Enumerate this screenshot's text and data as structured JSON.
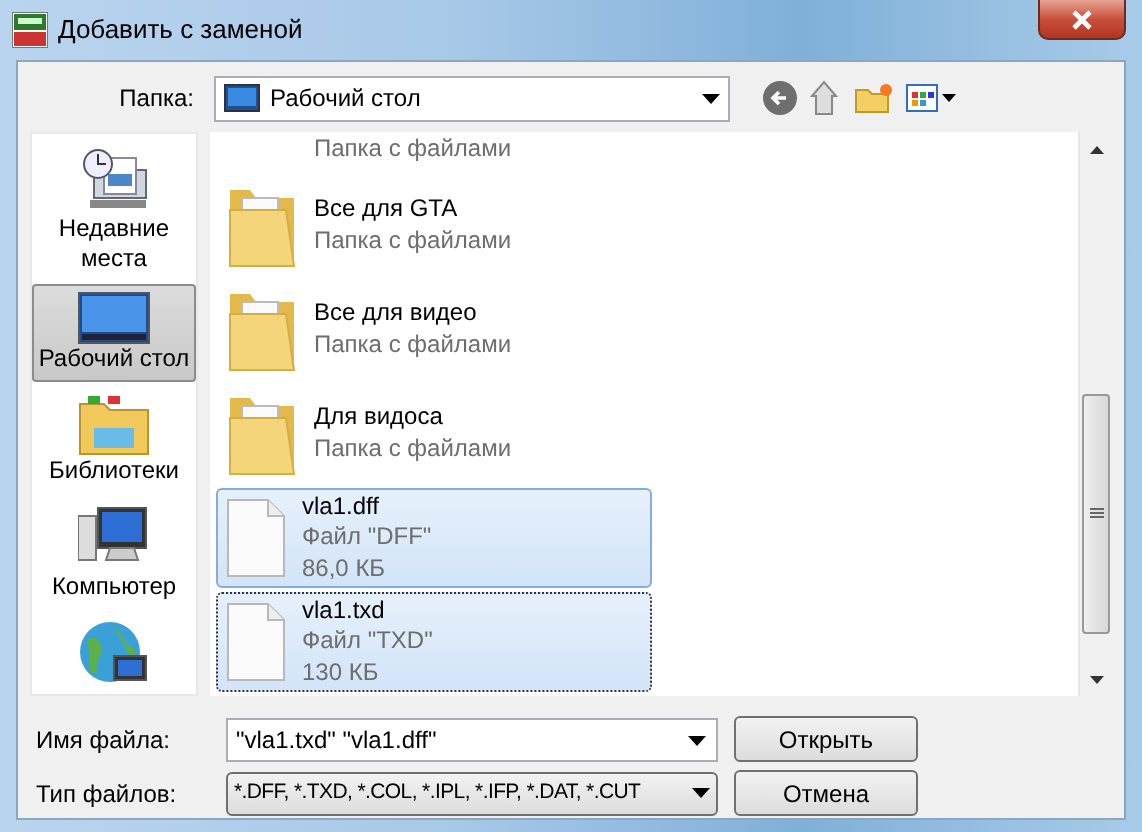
{
  "window": {
    "title": "Добавить с заменой"
  },
  "location": {
    "label": "Папка:",
    "value": "Рабочий стол"
  },
  "places": [
    {
      "kind": "recent",
      "label": "Недавние места",
      "selected": false
    },
    {
      "kind": "desktop",
      "label": "Рабочий стол",
      "selected": true
    },
    {
      "kind": "libraries",
      "label": "Библиотеки",
      "selected": false
    },
    {
      "kind": "computer",
      "label": "Компьютер",
      "selected": false
    },
    {
      "kind": "network",
      "selected": false
    }
  ],
  "files": [
    {
      "kind": "folder",
      "type": "Папка с файлами",
      "selected": false,
      "focused": false
    },
    {
      "kind": "folder",
      "name": "Все для GTA",
      "type": "Папка с файлами",
      "selected": false,
      "focused": false
    },
    {
      "kind": "folder",
      "name": "Все для видео",
      "type": "Папка с файлами",
      "selected": false,
      "focused": false
    },
    {
      "kind": "folder",
      "name": "Для видоса",
      "type": "Папка с файлами",
      "selected": false,
      "focused": false
    },
    {
      "kind": "file",
      "name": "vla1.dff",
      "type": "Файл \"DFF\"",
      "size": "86,0 КБ",
      "selected": true,
      "focused": false
    },
    {
      "kind": "file",
      "name": "vla1.txd",
      "type": "Файл \"TXD\"",
      "size": "130 КБ",
      "selected": true,
      "focused": true
    }
  ],
  "filename": {
    "label": "Имя файла:",
    "value": "\"vla1.txd\" \"vla1.dff\""
  },
  "filetype": {
    "label": "Тип файлов:",
    "value": "*.DFF, *.TXD, *.COL, *.IPL, *.IFP, *.DAT, *.CUT"
  },
  "buttons": [
    "Открыть",
    "Отмена"
  ]
}
